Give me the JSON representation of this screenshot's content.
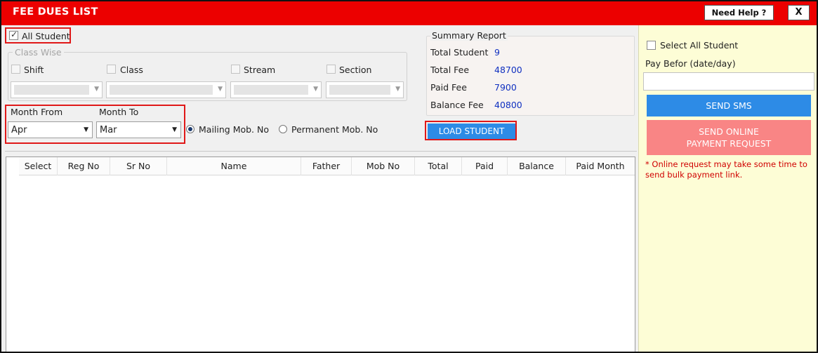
{
  "window": {
    "title": "FEE DUES LIST",
    "help_label": "Need Help ?",
    "close_label": "X"
  },
  "filters": {
    "all_student_label": "All Student",
    "all_student_checked": true,
    "class_wise_label": "Class Wise",
    "shift_label": "Shift",
    "class_label": "Class",
    "stream_label": "Stream",
    "section_label": "Section",
    "month_from_label": "Month From",
    "month_from_value": "Apr",
    "month_to_label": "Month To",
    "month_to_value": "Mar",
    "mailing_label": "Mailing Mob. No",
    "permanent_label": "Permanent Mob. No",
    "mailing_selected": true
  },
  "summary": {
    "title": "Summary Report",
    "rows": [
      {
        "label": "Total Student",
        "value": "9"
      },
      {
        "label": "Total Fee",
        "value": "48700"
      },
      {
        "label": "Paid Fee",
        "value": "7900"
      },
      {
        "label": "Balance Fee",
        "value": "40800"
      }
    ]
  },
  "load_button": "LOAD STUDENT",
  "table": {
    "columns": [
      "Select",
      "Reg No",
      "Sr No",
      "Name",
      "Father",
      "Mob No",
      "Total",
      "Paid",
      "Balance",
      "Paid Month"
    ],
    "rows": []
  },
  "side": {
    "select_all_label": "Select All Student",
    "pay_before_label": "Pay Befor (date/day)",
    "pay_before_value": "",
    "send_sms_label": "SEND SMS",
    "send_online_line1": "SEND ONLINE",
    "send_online_line2": "PAYMENT REQUEST",
    "note": "* Online request may take some time to send bulk payment link."
  },
  "colors": {
    "title_bar": "#ec0000",
    "primary_button": "#2d8be6",
    "disabled_button": "#f98585",
    "side_panel": "#fdfdd6",
    "highlight_box": "#e01818",
    "summary_value": "#1030c0"
  }
}
